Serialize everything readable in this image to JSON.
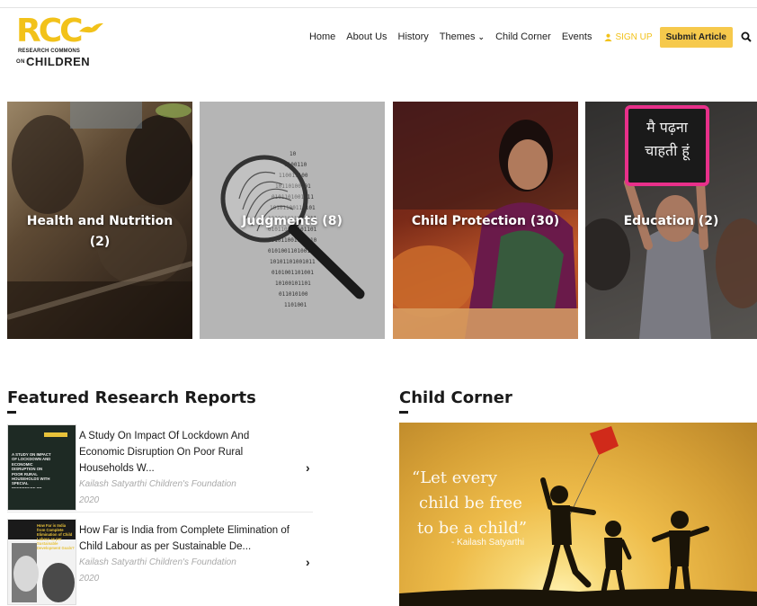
{
  "header": {
    "logo": {
      "main": "RCC",
      "sub_line1": "RESEARCH COMMONS",
      "sub_of": "ON",
      "sub_line2": "CHILDREN"
    },
    "nav": [
      "Home",
      "About Us",
      "History",
      "Themes",
      "Child Corner",
      "Events"
    ],
    "signup_label": "SIGN UP",
    "submit_label": "Submit Article",
    "accent_color": "#f2c21a"
  },
  "themes": [
    {
      "label": "Health and Nutrition (2)"
    },
    {
      "label": "Judgments (8)"
    },
    {
      "label": "Child Protection (30)"
    },
    {
      "label": "Education (2)"
    }
  ],
  "featured": {
    "title": "Featured Research Reports",
    "reports": [
      {
        "title": "A Study On Impact Of Lockdown And Economic Disruption On Poor Rural Households W...",
        "org": "Kailash Satyarthi Children's Foundation",
        "year": "2020",
        "thumb_text": "A STUDY ON IMPACT OF LOCKDOWN AND ECONOMIC DISRUPTION ON POOR RURAL HOUSEHOLDS WITH SPECIAL REFERENCE TO CHILDREN"
      },
      {
        "title": "How Far is India from Complete Elimination of Child Labour as per Sustainable De...",
        "org": "Kailash Satyarthi Children's Foundation",
        "year": "2020",
        "thumb_text": "How Far is India from Complete Elimination of Child Labour as per Sustainable Development Goals?"
      }
    ]
  },
  "child_corner": {
    "title": "Child Corner",
    "quote_lines": [
      "“Let every",
      "child be free",
      "to be a child”"
    ],
    "author": "- Kailash Satyarthi"
  },
  "education_board": [
    "मै पढ़ना",
    "चाहती हूं"
  ]
}
